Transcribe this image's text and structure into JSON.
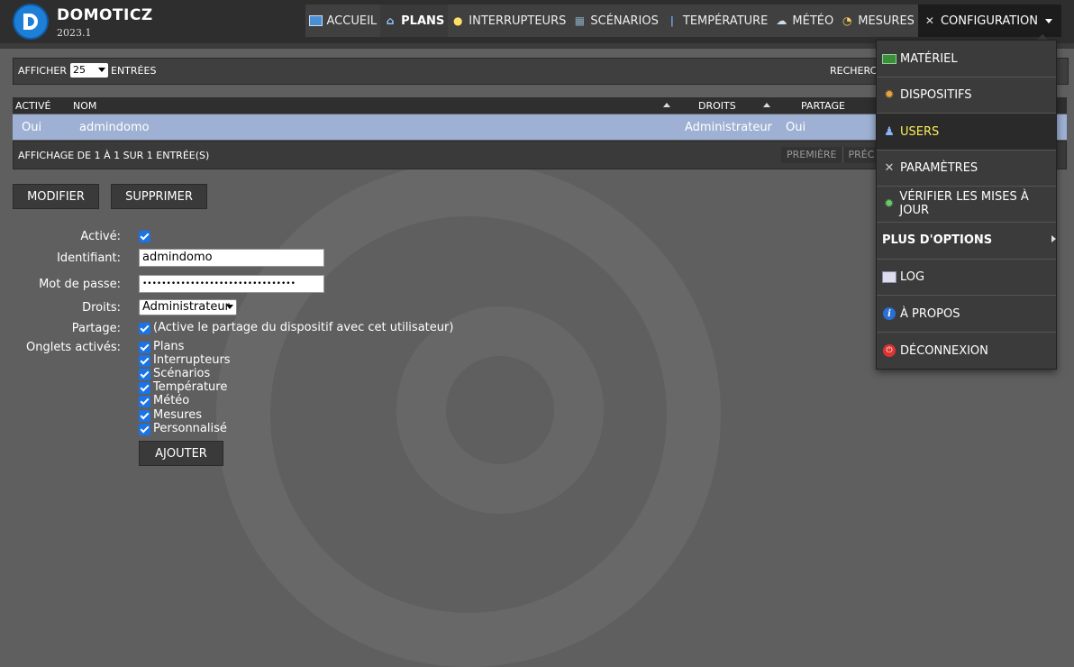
{
  "brand": {
    "name": "DOMOTICZ",
    "version": "2023.1"
  },
  "nav": {
    "items": [
      {
        "label": "ACCUEIL",
        "icon": "dashboard-icon"
      },
      {
        "label": "PLANS",
        "icon": "house-icon"
      },
      {
        "label": "INTERRUPTEURS",
        "icon": "bulb-icon"
      },
      {
        "label": "SCÉNARIOS",
        "icon": "clapperboard-icon"
      },
      {
        "label": "TEMPÉRATURE",
        "icon": "thermometer-icon"
      },
      {
        "label": "MÉTÉO",
        "icon": "weather-icon"
      },
      {
        "label": "MESURES",
        "icon": "gauge-icon"
      },
      {
        "label": "CONFIGURATION",
        "icon": "tools-icon"
      }
    ]
  },
  "table": {
    "show_prefix": "AFFICHER",
    "page_size": "25",
    "show_suffix": "ENTRÉES",
    "search_label": "RECHERC",
    "headers": {
      "active": "ACTIVÉ",
      "name": "NOM",
      "rights": "DROITS",
      "share": "PARTAGE"
    },
    "rows": [
      {
        "active": "Oui",
        "name": "admindomo",
        "rights": "Administrateur",
        "share": "Oui"
      }
    ],
    "info": "AFFICHAGE DE 1 À 1 SUR 1 ENTRÉE(S)",
    "pager": {
      "first": "PREMIÈRE",
      "prev": "PRÉC"
    }
  },
  "actions": {
    "modify": "MODIFIER",
    "delete": "SUPPRIMER"
  },
  "form": {
    "active_label": "Activé:",
    "username_label": "Identifiant:",
    "username_value": "admindomo",
    "password_label": "Mot de passe:",
    "password_value": "••••••••••••••••••••••••••••••••",
    "rights_label": "Droits:",
    "rights_value": "Administrateur",
    "share_label": "Partage:",
    "share_text": "(Active le partage du dispositif avec cet utilisateur)",
    "tabs_label": "Onglets activés:",
    "tabs": [
      "Plans",
      "Interrupteurs",
      "Scénarios",
      "Température",
      "Météo",
      "Mesures",
      "Personnalisé"
    ],
    "add_button": "AJOUTER"
  },
  "config_menu": {
    "items": [
      {
        "label": "MATÉRIEL",
        "icon": "hardware-board-icon"
      },
      {
        "label": "DISPOSITIFS",
        "icon": "gear-icon"
      },
      {
        "label": "USERS",
        "icon": "user-icon"
      },
      {
        "label": "PARAMÈTRES",
        "icon": "tools-icon"
      },
      {
        "label": "VÉRIFIER LES MISES À JOUR",
        "icon": "update-gear-icon"
      },
      {
        "label": "PLUS D'OPTIONS",
        "icon": ""
      },
      {
        "label": "LOG",
        "icon": "log-list-icon"
      },
      {
        "label": "À PROPOS",
        "icon": "info-icon"
      },
      {
        "label": "DÉCONNEXION",
        "icon": "power-icon"
      }
    ]
  },
  "colors": {
    "selected_row": "#9eb1d4",
    "checkbox": "#1a73e8",
    "active_menu_text": "#ffee58"
  }
}
